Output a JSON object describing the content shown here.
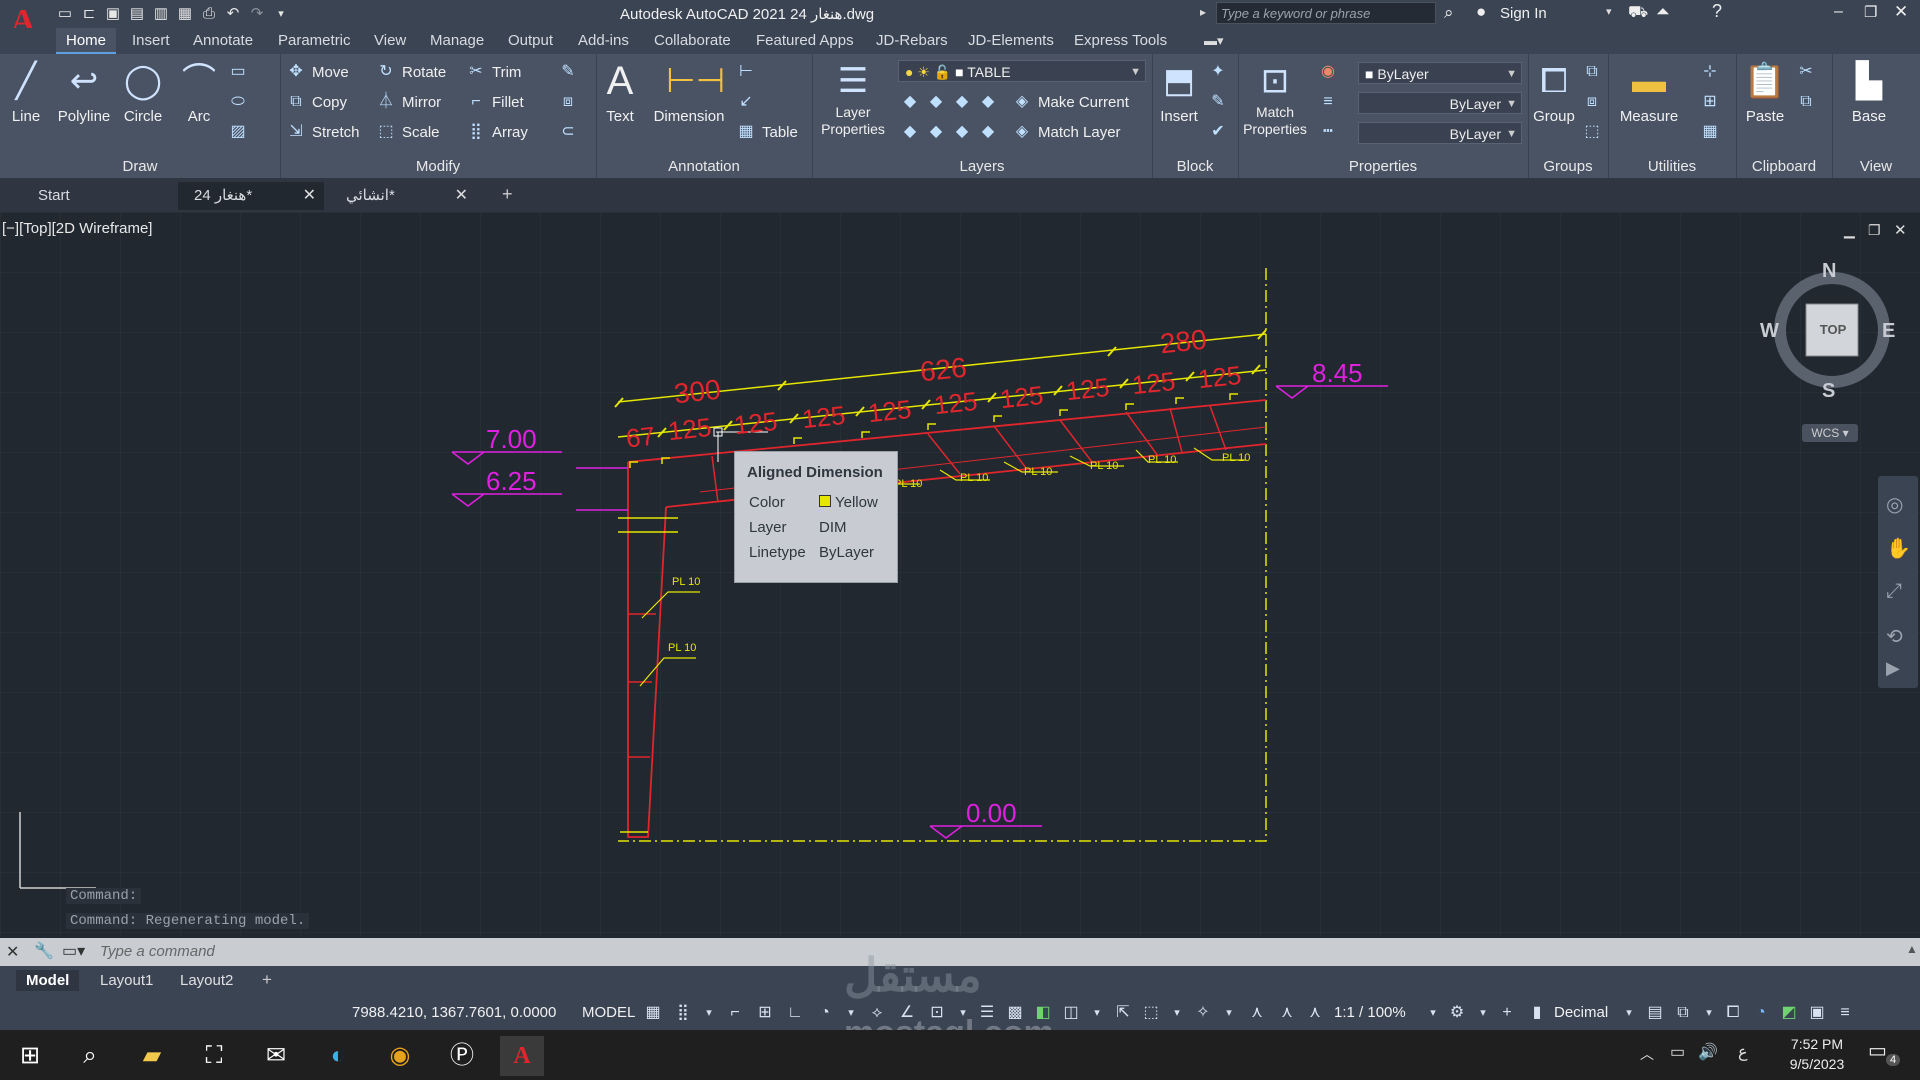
{
  "app": {
    "title": "Autodesk AutoCAD 2021   هنغار 24.dwg",
    "search_placeholder": "Type a keyword or phrase",
    "sign_in": "Sign In"
  },
  "ribbon_tabs": [
    "Home",
    "Insert",
    "Annotate",
    "Parametric",
    "View",
    "Manage",
    "Output",
    "Add-ins",
    "Collaborate",
    "Featured Apps",
    "JD-Rebars",
    "JD-Elements",
    "Express Tools"
  ],
  "ribbon": {
    "draw": {
      "title": "Draw",
      "line": "Line",
      "polyline": "Polyline",
      "circle": "Circle",
      "arc": "Arc"
    },
    "modify": {
      "title": "Modify",
      "move": "Move",
      "rotate": "Rotate",
      "trim": "Trim",
      "copy": "Copy",
      "mirror": "Mirror",
      "fillet": "Fillet",
      "stretch": "Stretch",
      "scale": "Scale",
      "array": "Array"
    },
    "annotation": {
      "title": "Annotation",
      "text": "Text",
      "dimension": "Dimension",
      "table": "Table"
    },
    "layers": {
      "title": "Layers",
      "layer_properties_1": "Layer",
      "layer_properties_2": "Properties",
      "current_layer": "TABLE",
      "make_current": "Make Current",
      "match_layer": "Match Layer"
    },
    "block": {
      "title": "Block",
      "insert": "Insert"
    },
    "properties": {
      "title": "Properties",
      "match_1": "Match",
      "match_2": "Properties",
      "color": "ByLayer",
      "linetype": "ByLayer",
      "lineweight": "ByLayer"
    },
    "groups": {
      "title": "Groups",
      "group": "Group"
    },
    "utilities": {
      "title": "Utilities",
      "measure": "Measure"
    },
    "clipboard": {
      "title": "Clipboard",
      "paste": "Paste"
    },
    "view": {
      "title": "View",
      "base": "Base"
    }
  },
  "doc_tabs": [
    {
      "label": "Start"
    },
    {
      "label": "هنغار 24*"
    },
    {
      "label": "انشائي*"
    }
  ],
  "viewport_label": "[−][Top][2D Wireframe]",
  "drawing": {
    "dims_top": [
      "300",
      "626",
      "280"
    ],
    "dims_row": [
      "67",
      "125",
      "125",
      "125",
      "125",
      "125",
      "125",
      "125",
      "125",
      "125"
    ],
    "levels": [
      "7.00",
      "6.25",
      "8.45",
      "0.00"
    ],
    "plate_label": "PL 10"
  },
  "tooltip": {
    "title": "Aligned Dimension",
    "rows": [
      {
        "key": "Color",
        "value": "Yellow"
      },
      {
        "key": "Layer",
        "value": "DIM"
      },
      {
        "key": "Linetype",
        "value": "ByLayer"
      }
    ]
  },
  "viewcube": {
    "n": "N",
    "s": "S",
    "e": "E",
    "w": "W",
    "top": "TOP",
    "wcs": "WCS"
  },
  "command": {
    "history": [
      "Command:",
      "Command: Regenerating model."
    ],
    "placeholder": "Type a command"
  },
  "layout_tabs": [
    "Model",
    "Layout1",
    "Layout2"
  ],
  "status": {
    "coords": "7988.4210, 1367.7601, 0.0000",
    "model": "MODEL",
    "scale": "1:1 / 100%",
    "units": "Decimal"
  },
  "taskbar": {
    "time": "7:52 PM",
    "date": "9/5/2023",
    "lang": "ع",
    "notif": "4"
  },
  "watermark": {
    "top": "مستقل",
    "bottom": "mostaql.com"
  },
  "colors": {
    "red": "#e0262c",
    "yellow": "#e6e600",
    "magenta": "#e020e0",
    "accent": "#5e9fe0"
  }
}
